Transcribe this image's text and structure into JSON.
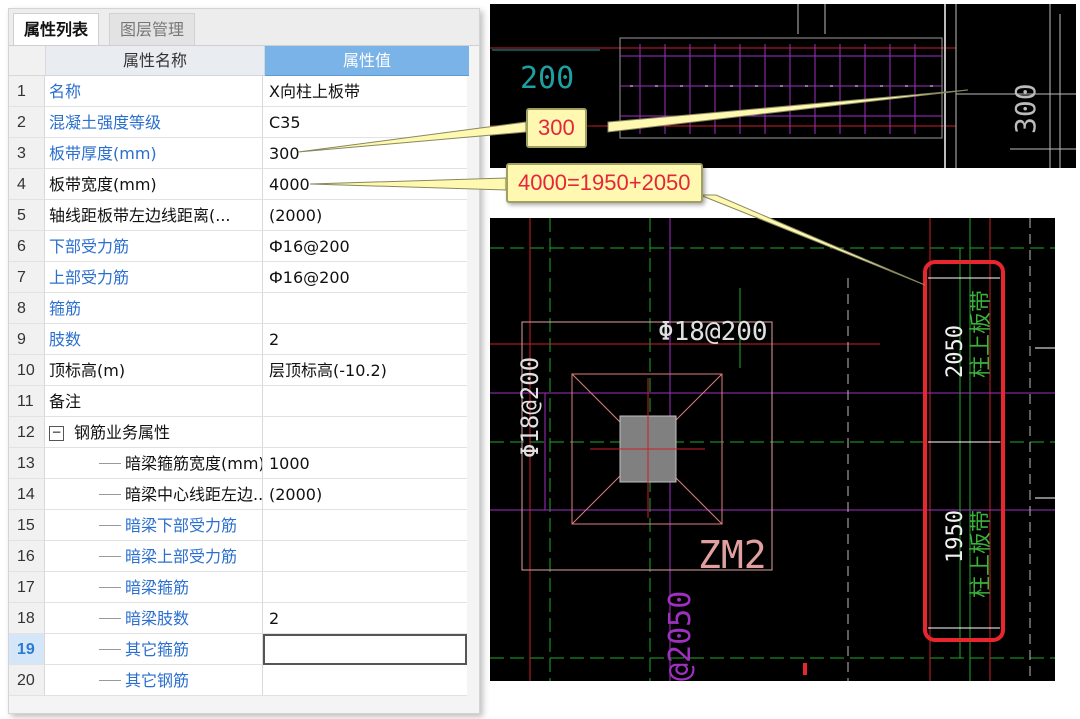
{
  "panel": {
    "tabs": [
      "属性列表",
      "图层管理"
    ],
    "columns": {
      "name": "属性名称",
      "value": "属性值"
    },
    "rows": [
      {
        "num": "1",
        "name": "名称",
        "value": "X向柱上板带",
        "color": "blue"
      },
      {
        "num": "2",
        "name": "混凝土强度等级",
        "value": "C35",
        "color": "blue"
      },
      {
        "num": "3",
        "name": "板带厚度(mm)",
        "value": "300",
        "color": "blue"
      },
      {
        "num": "4",
        "name": "板带宽度(mm)",
        "value": "4000",
        "color": "black"
      },
      {
        "num": "5",
        "name": "轴线距板带左边线距离(...",
        "value": "(2000)",
        "color": "black"
      },
      {
        "num": "6",
        "name": "下部受力筋",
        "value": "Ф16@200",
        "color": "blue"
      },
      {
        "num": "7",
        "name": "上部受力筋",
        "value": "Ф16@200",
        "color": "blue"
      },
      {
        "num": "8",
        "name": "箍筋",
        "value": "",
        "color": "blue"
      },
      {
        "num": "9",
        "name": "肢数",
        "value": "2",
        "color": "blue"
      },
      {
        "num": "10",
        "name": "顶标高(m)",
        "value": "层顶标高(-10.2)",
        "color": "black"
      },
      {
        "num": "11",
        "name": "备注",
        "value": "",
        "color": "black"
      },
      {
        "num": "12",
        "name": "钢筋业务属性",
        "value": "",
        "color": "black"
      },
      {
        "num": "13",
        "name": "暗梁箍筋宽度(mm)",
        "value": "1000",
        "color": "black"
      },
      {
        "num": "14",
        "name": "暗梁中心线距左边...",
        "value": "(2000)",
        "color": "black"
      },
      {
        "num": "15",
        "name": "暗梁下部受力筋",
        "value": "",
        "color": "blue"
      },
      {
        "num": "16",
        "name": "暗梁上部受力筋",
        "value": "",
        "color": "blue"
      },
      {
        "num": "17",
        "name": "暗梁箍筋",
        "value": "",
        "color": "blue"
      },
      {
        "num": "18",
        "name": "暗梁肢数",
        "value": "2",
        "color": "blue"
      },
      {
        "num": "19",
        "name": "其它箍筋",
        "value": "",
        "color": "blue"
      },
      {
        "num": "20",
        "name": "其它钢筋",
        "value": "",
        "color": "blue"
      }
    ],
    "group_toggle": "−"
  },
  "callouts": {
    "thickness": "300",
    "width": "4000=1950+2050"
  },
  "cad_top": {
    "label_200": "200",
    "label_300": "300"
  },
  "cad_bottom": {
    "rebar_h": "Φ18@200",
    "rebar_v": "Φ18@200",
    "column_label": "ZM2",
    "dim_2050": "2050",
    "dim_1950": "1950",
    "strip_label": "柱上板带",
    "partial_label": "@2050"
  },
  "colors": {
    "callout_text": "#e6263c",
    "callout_bg": "#fff8b0",
    "highlight_box": "#e8262e",
    "header_blue": "#79b3e8"
  }
}
